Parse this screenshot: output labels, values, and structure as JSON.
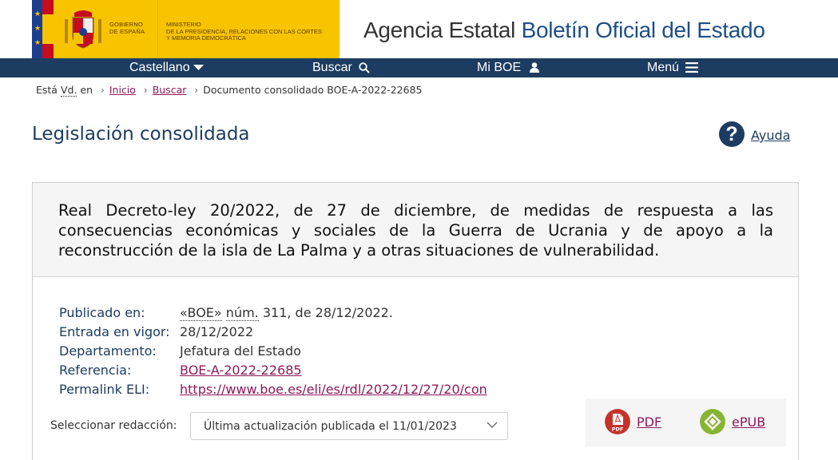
{
  "header": {
    "gov_line1": "GOBIERNO",
    "gov_line2": "DE ESPAÑA",
    "ministry_line1": "MINISTERIO",
    "ministry_line2": "DE LA PRESIDENCIA, RELACIONES CON LAS CORTES",
    "ministry_line3": "Y MEMORIA DEMOCRÁTICA",
    "agency_part1": "Agencia Estatal",
    "agency_part2": "Boletín Oficial del Estado"
  },
  "nav": {
    "language": "Castellano",
    "search": "Buscar",
    "my_boe": "Mi BOE",
    "menu": "Menú"
  },
  "breadcrumb": {
    "prefix_1": "Está",
    "prefix_abbr": "Vd.",
    "prefix_2": "en",
    "home": "Inicio",
    "search": "Buscar",
    "current": "Documento consolidado BOE-A-2022-22685"
  },
  "page": {
    "title": "Legislación consolidada",
    "help": "Ayuda"
  },
  "document": {
    "title": "Real Decreto-ley 20/2022, de 27 de diciembre, de medidas de respuesta a las consecuencias económicas y sociales de la Guerra de Ucrania y de apoyo a la reconstrucción de la isla de La Palma y a otras situaciones de vulnerabilidad.",
    "published_label": "Publicado en:",
    "published_boe": "«BOE»",
    "published_num": "núm.",
    "published_rest": "311, de 28/12/2022.",
    "in_force_label": "Entrada en vigor:",
    "in_force_value": "28/12/2022",
    "department_label": "Departamento:",
    "department_value": "Jefatura del Estado",
    "reference_label": "Referencia:",
    "reference_value": "BOE-A-2022-22685",
    "eli_label": "Permalink ELI:",
    "eli_value": "https://www.boe.es/eli/es/rdl/2022/12/27/20/con"
  },
  "version": {
    "label": "Seleccionar redacción:",
    "selected": "Última actualización publicada el 11/01/2023"
  },
  "downloads": {
    "pdf": "PDF",
    "pdf_badge": "PDF",
    "epub": "ePUB"
  },
  "colors": {
    "navy": "#1c3c61",
    "link": "#8b1a5a",
    "gov_yellow": "#f8c400",
    "pdf_red": "#c4322b",
    "epub_green": "#86b534"
  }
}
